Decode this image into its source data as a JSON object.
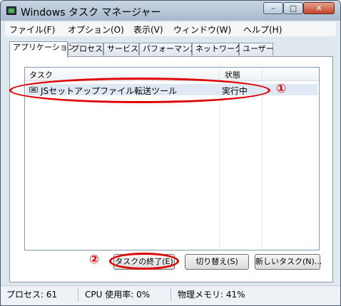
{
  "window": {
    "title": "Windows タスク マネージャー"
  },
  "titlebar_buttons": {
    "minimize": "–",
    "maximize": "□",
    "close": "✕"
  },
  "menu": [
    "ファイル(F)",
    "オプション(O)",
    "表示(V)",
    "ウィンドウ(W)",
    "ヘルプ(H)"
  ],
  "tabs": [
    "アプリケーション",
    "プロセス",
    "サービス",
    "パフォーマンス",
    "ネットワーク",
    "ユーザー"
  ],
  "active_tab": "アプリケーション",
  "tasks": {
    "columns": [
      "タスク",
      "状態"
    ],
    "rows": [
      {
        "name": "JSセットアップファイル転送ツール",
        "status": "実行中"
      }
    ]
  },
  "buttons": {
    "end_task": "タスクの終了(E)",
    "switch_to": "切り替え(S)",
    "new_task": "新しいタスク(N)..."
  },
  "annotations": [
    "①",
    "②"
  ],
  "status_bar": {
    "processes": "プロセス: 61",
    "cpu": "CPU 使用率: 0%",
    "memory": "物理メモリ: 41%"
  },
  "colors": {
    "annotation": "#e00000",
    "selected_row": "#dfe9f5"
  }
}
